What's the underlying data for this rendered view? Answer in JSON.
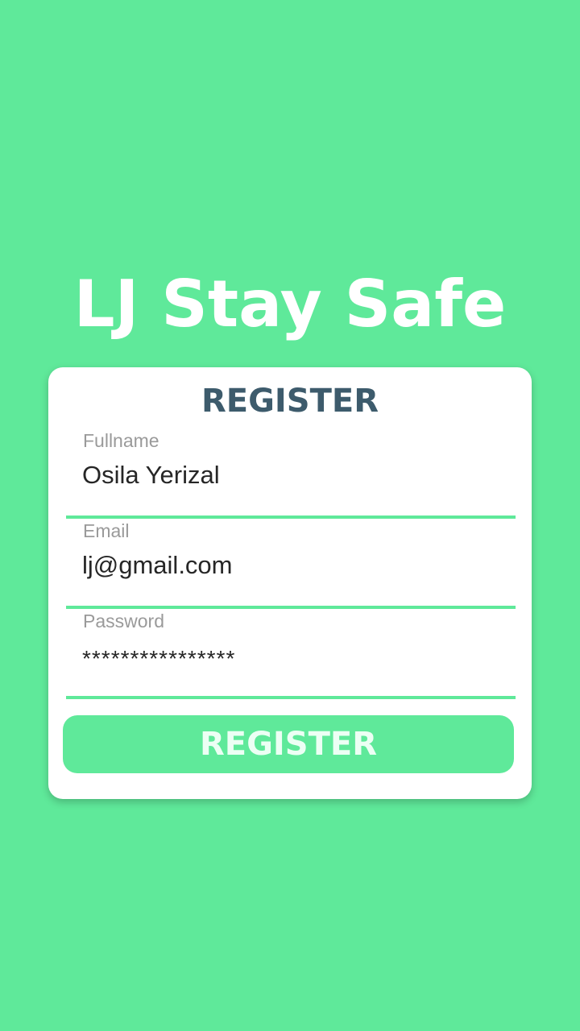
{
  "app": {
    "title": "LJ Stay Safe"
  },
  "form": {
    "heading": "REGISTER",
    "fields": [
      {
        "label": "Fullname",
        "value": "Osila Yerizal"
      },
      {
        "label": "Email",
        "value": "lj@gmail.com"
      },
      {
        "label": "Password",
        "value": "****************"
      }
    ],
    "submit_label": "REGISTER"
  },
  "colors": {
    "background": "#5fe99a",
    "card": "#ffffff",
    "heading": "#3d5b6c",
    "label": "#9a9a9a",
    "input_text": "#262626",
    "accent": "#5fe99a",
    "button_text": "#ecfff4"
  }
}
